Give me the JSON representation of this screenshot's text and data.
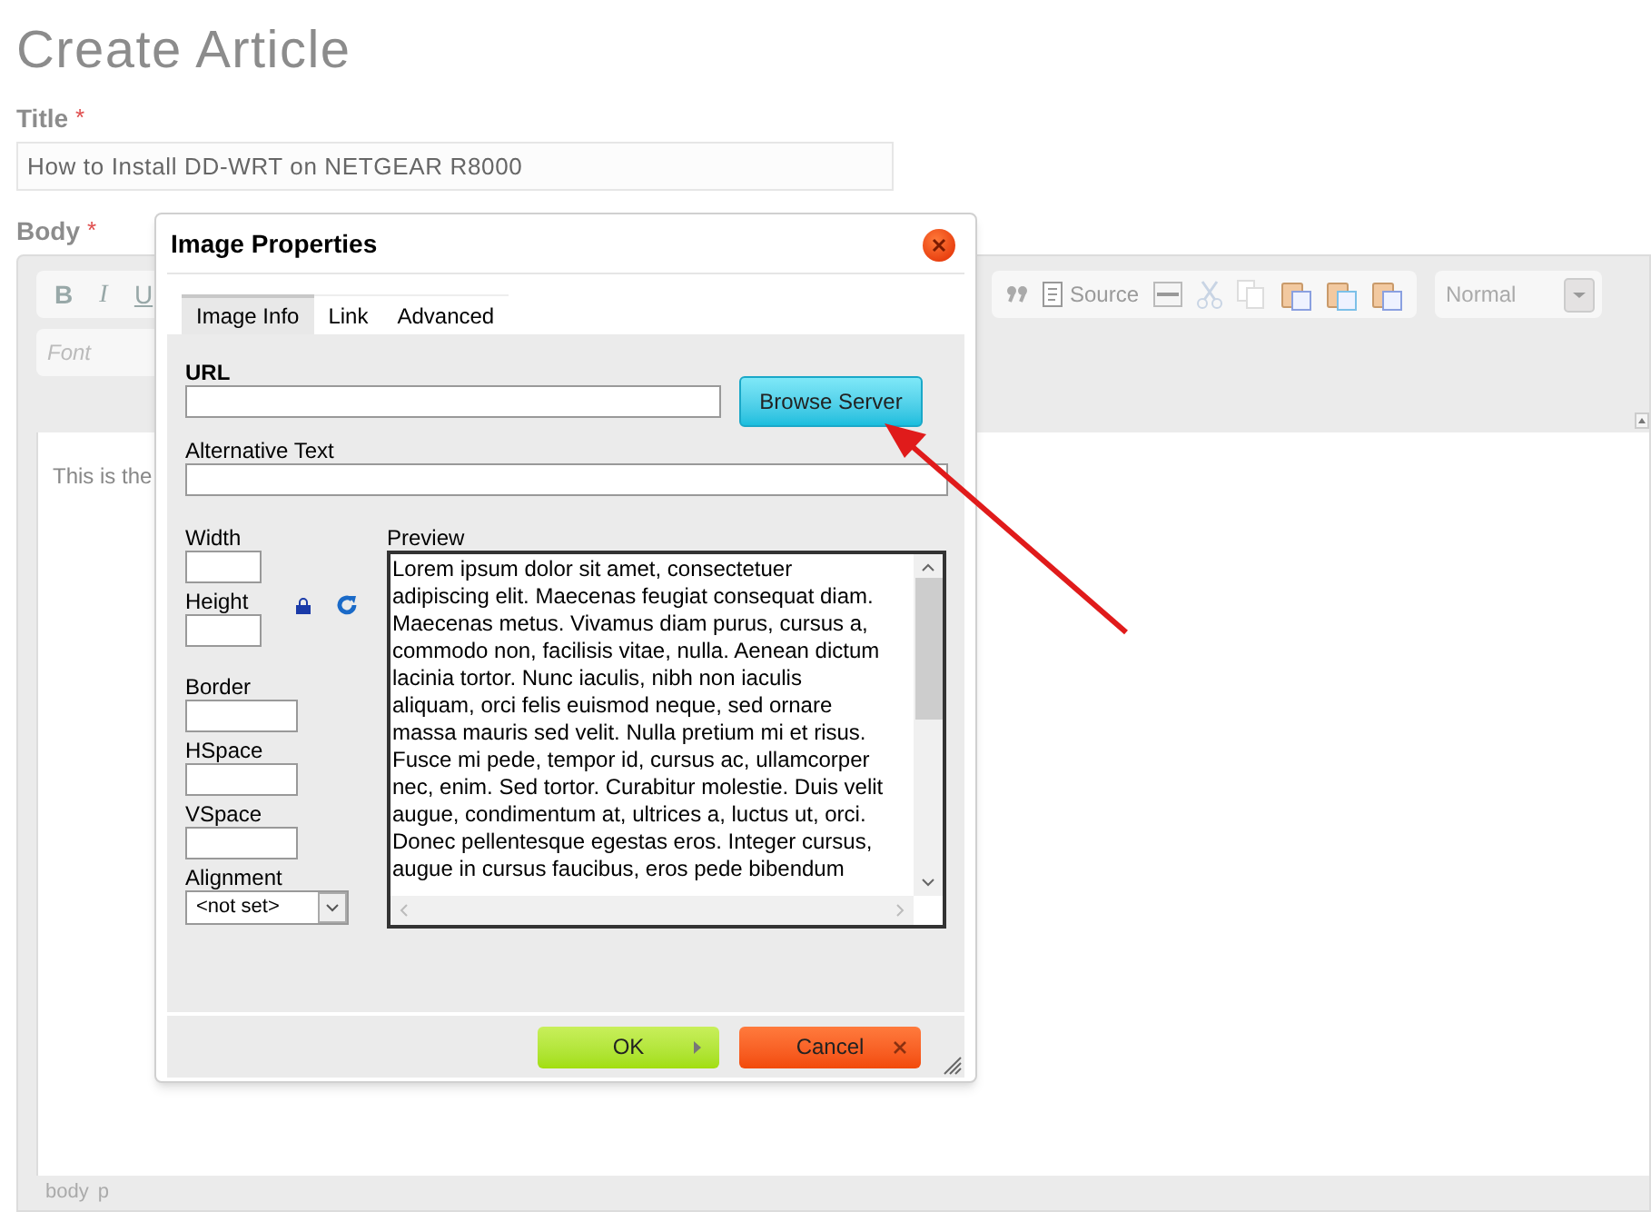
{
  "page_title": "Create Article",
  "title_field": {
    "label": "Title",
    "required_mark": "*",
    "value": "How to Install DD-WRT on NETGEAR R8000"
  },
  "body_field": {
    "label": "Body",
    "required_mark": "*",
    "toolbar_letters": [
      "B",
      "I",
      "U"
    ],
    "source_button": {
      "label": "Source"
    },
    "format_dropdown": {
      "value": "Normal"
    },
    "font_dropdown": {
      "placeholder": "Font"
    },
    "content": "This is the",
    "path": [
      "body",
      "p"
    ]
  },
  "dialog": {
    "title": "Image Properties",
    "tabs": [
      {
        "label": "Image Info",
        "selected": true
      },
      {
        "label": "Link",
        "selected": false
      },
      {
        "label": "Advanced",
        "selected": false
      }
    ],
    "url": {
      "label": "URL"
    },
    "browse_button": "Browse Server",
    "alt_text": {
      "label": "Alternative Text"
    },
    "fields": [
      {
        "label": "Width",
        "kind": "narrow"
      },
      {
        "label": "Height",
        "kind": "narrow"
      },
      {
        "label": "Border",
        "kind": "wide"
      },
      {
        "label": "HSpace",
        "kind": "wide"
      },
      {
        "label": "VSpace",
        "kind": "wide"
      }
    ],
    "alignment": {
      "label": "Alignment",
      "value": "<not set>"
    },
    "preview": {
      "label": "Preview",
      "text": "Lorem ipsum dolor sit amet, consectetuer adipiscing elit. Maecenas feugiat consequat diam. Maecenas metus. Vivamus diam purus, cursus a, commodo non, facilisis vitae, nulla. Aenean dictum lacinia tortor. Nunc iaculis, nibh non iaculis aliquam, orci felis euismod neque, sed ornare massa mauris sed velit. Nulla pretium mi et risus. Fusce mi pede, tempor id, cursus ac, ullamcorper nec, enim. Sed tortor. Curabitur molestie. Duis velit augue, condimentum at, ultrices a, luctus ut, orci. Donec pellentesque egestas eros. Integer cursus, augue in cursus faucibus, eros pede bibendum"
    },
    "ok_button": "OK",
    "cancel_button": "Cancel"
  }
}
